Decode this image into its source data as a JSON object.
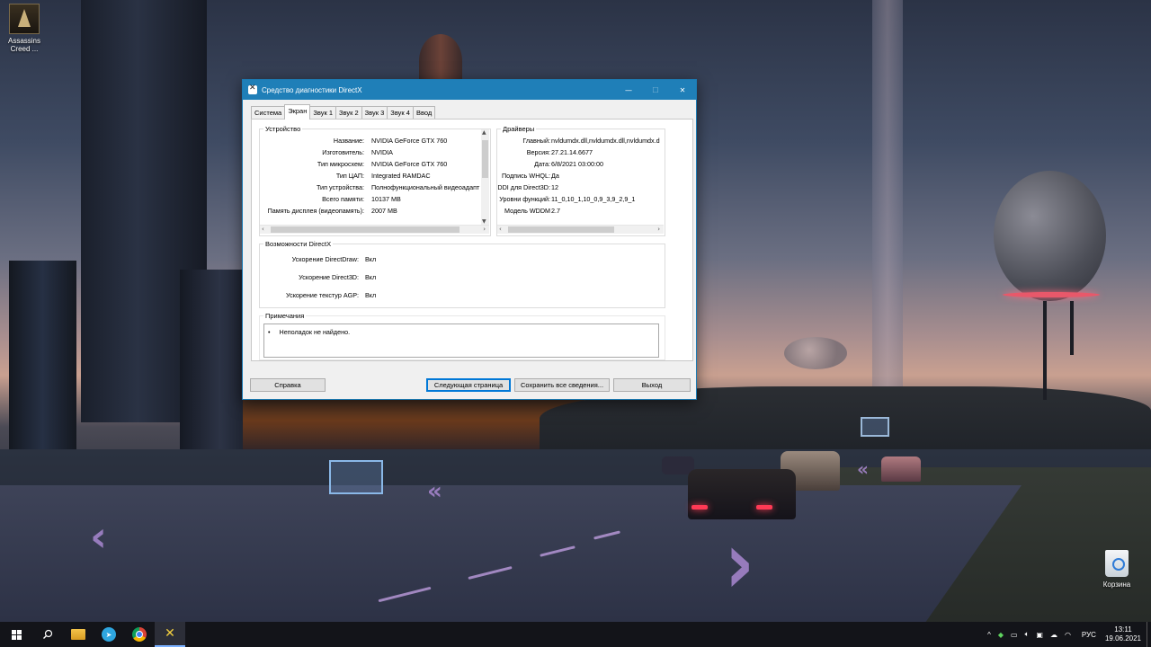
{
  "desktop": {
    "icons": [
      {
        "label": "Assassins Creed ..."
      },
      {
        "label": "Корзина"
      }
    ]
  },
  "window": {
    "title": "Средство диагностики DirectX",
    "controls": {
      "minimize": "—",
      "maximize": "☐",
      "close": "✕"
    },
    "tabs": [
      {
        "label": "Система"
      },
      {
        "label": "Экран",
        "active": true
      },
      {
        "label": "Звук 1"
      },
      {
        "label": "Звук 2"
      },
      {
        "label": "Звук 3"
      },
      {
        "label": "Звук 4"
      },
      {
        "label": "Ввод"
      }
    ],
    "device": {
      "title": "Устройство",
      "rows": [
        {
          "label": "Название:",
          "value": "NVIDIA GeForce GTX 760"
        },
        {
          "label": "Изготовитель:",
          "value": "NVIDIA"
        },
        {
          "label": "Тип микросхем:",
          "value": "NVIDIA GeForce GTX 760"
        },
        {
          "label": "Тип ЦАП:",
          "value": "Integrated RAMDAC"
        },
        {
          "label": "Тип устройства:",
          "value": "Полнофункциональный видеоадапт"
        },
        {
          "label": "Всего памяти:",
          "value": "10137 MB"
        },
        {
          "label": "Память дисплея (видеопамять):",
          "value": "2007 MB"
        }
      ]
    },
    "drivers": {
      "title": "Драйверы",
      "rows": [
        {
          "label": "Главный:",
          "value": "nvldumdx.dll,nvldumdx.dll,nvldumdx.d"
        },
        {
          "label": "Версия:",
          "value": "27.21.14.6677"
        },
        {
          "label": "Дата:",
          "value": "6/8/2021 03:00:00"
        },
        {
          "label": "Подпись WHQL:",
          "value": "Да"
        },
        {
          "label": "DDI для Direct3D:",
          "value": "12"
        },
        {
          "label": "Уровни функций:",
          "value": "11_0,10_1,10_0,9_3,9_2,9_1"
        },
        {
          "label": "Модель WDDM",
          "value": "2.7"
        }
      ]
    },
    "features": {
      "title": "Возможности DirectX",
      "rows": [
        {
          "label": "Ускорение DirectDraw:",
          "value": "Вкл"
        },
        {
          "label": "Ускорение Direct3D:",
          "value": "Вкл"
        },
        {
          "label": "Ускорение текстур AGP:",
          "value": "Вкл"
        }
      ]
    },
    "notes": {
      "title": "Примечания",
      "items": [
        "Неполадок не найдено."
      ]
    },
    "buttons": {
      "help": "Справка",
      "next": "Следующая страница",
      "save": "Сохранить все сведения...",
      "exit": "Выход"
    }
  },
  "taskbar": {
    "tray": {
      "language": "РУС",
      "time": "13:11",
      "date": "19.06.2021"
    }
  }
}
